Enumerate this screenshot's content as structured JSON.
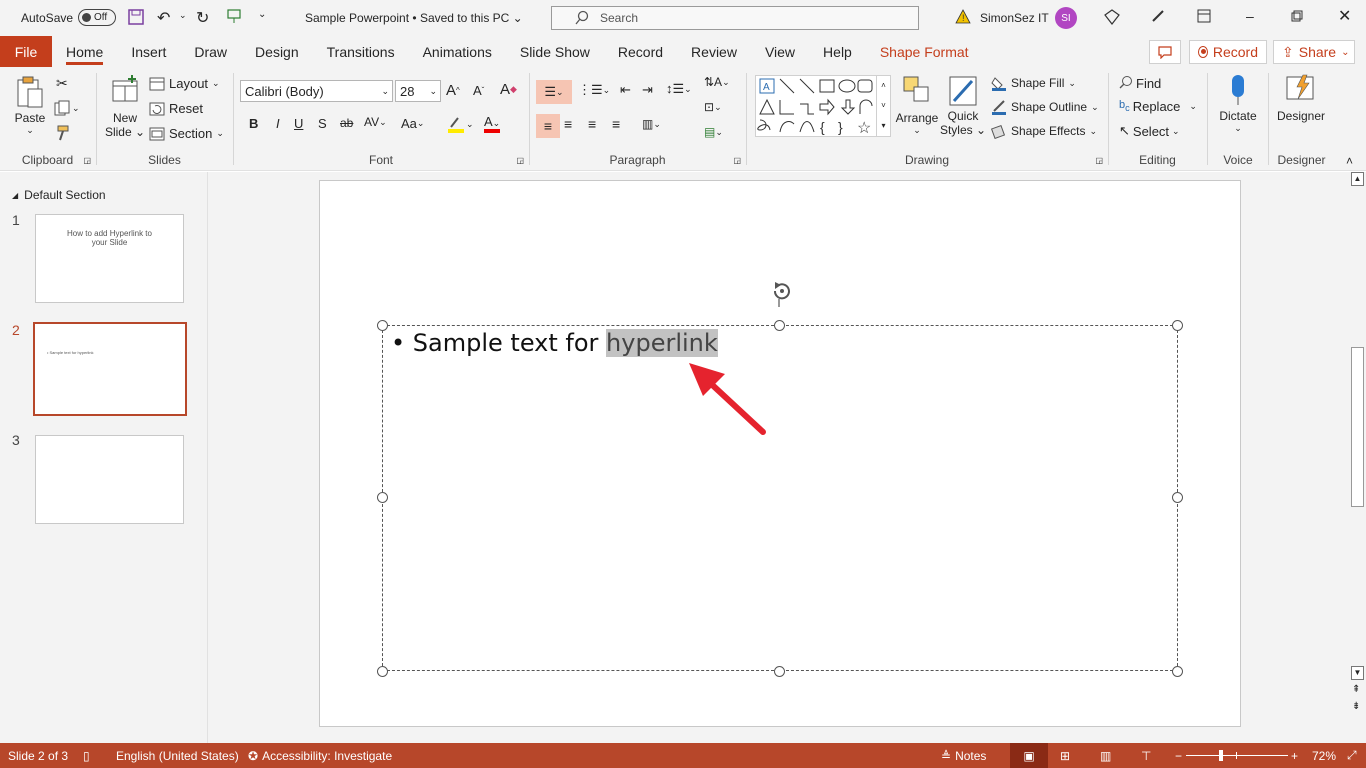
{
  "titlebar": {
    "autosave_label": "AutoSave",
    "autosave_state": "Off",
    "doc_title": "Sample Powerpoint",
    "save_status": "Saved to this PC",
    "search_placeholder": "Search",
    "user_name": "SimonSez IT",
    "user_initials": "SI"
  },
  "menu": {
    "tabs": [
      "File",
      "Home",
      "Insert",
      "Draw",
      "Design",
      "Transitions",
      "Animations",
      "Slide Show",
      "Record",
      "Review",
      "View",
      "Help",
      "Shape Format"
    ],
    "record_label": "Record",
    "share_label": "Share"
  },
  "ribbon": {
    "clipboard": {
      "paste": "Paste",
      "label": "Clipboard"
    },
    "slides": {
      "new_slide_1": "New",
      "new_slide_2": "Slide",
      "layout": "Layout",
      "reset": "Reset",
      "section": "Section",
      "label": "Slides"
    },
    "font": {
      "family": "Calibri (Body)",
      "size": "28",
      "label": "Font"
    },
    "paragraph": {
      "label": "Paragraph"
    },
    "drawing": {
      "arrange": "Arrange",
      "quick_styles_1": "Quick",
      "quick_styles_2": "Styles",
      "shape_fill": "Shape Fill",
      "shape_outline": "Shape Outline",
      "shape_effects": "Shape Effects",
      "label": "Drawing"
    },
    "editing": {
      "find": "Find",
      "replace": "Replace",
      "select": "Select",
      "label": "Editing"
    },
    "voice": {
      "dictate": "Dictate",
      "label": "Voice"
    },
    "designer": {
      "designer": "Designer",
      "label": "Designer"
    }
  },
  "slides_panel": {
    "section_name": "Default Section",
    "slides": [
      {
        "num": "1",
        "text": "How to add Hyperlink to your Slide"
      },
      {
        "num": "2",
        "text": "Sample text for hyperlink"
      },
      {
        "num": "3",
        "text": ""
      }
    ]
  },
  "slide": {
    "bullet_text_before": "Sample text for ",
    "bullet_text_selected": "hyperlink"
  },
  "status": {
    "slide_info": "Slide 2 of 3",
    "language": "English (United States)",
    "accessibility": "Accessibility: Investigate",
    "notes": "Notes",
    "zoom": "72%"
  }
}
